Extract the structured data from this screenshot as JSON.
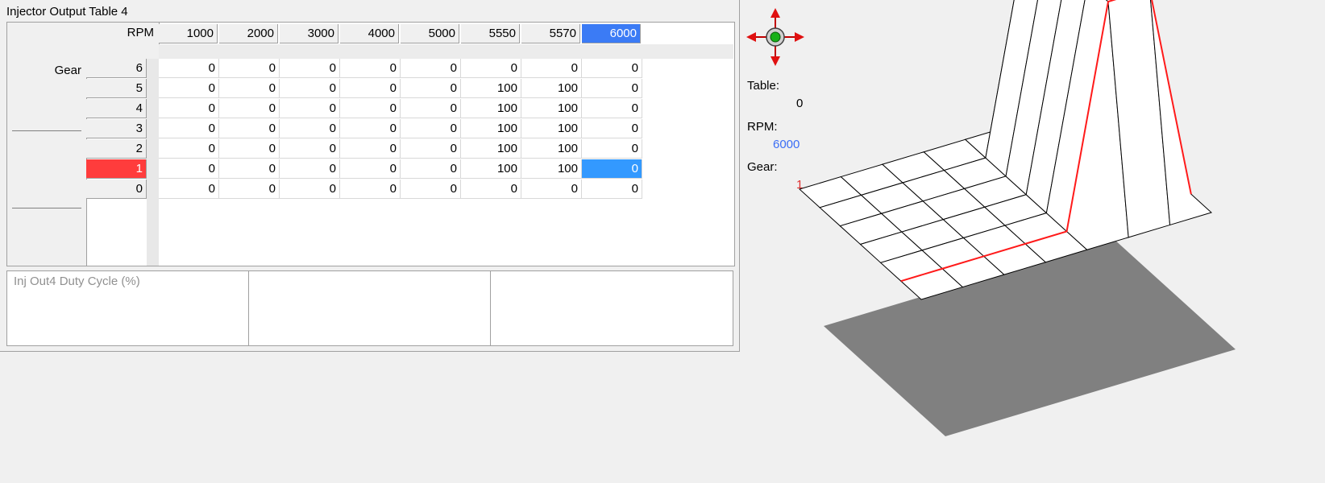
{
  "panel": {
    "title": "Injector Output Table 4"
  },
  "table": {
    "x_axis_label": "RPM",
    "y_axis_label": "Gear",
    "rpm_columns": [
      "1000",
      "2000",
      "3000",
      "4000",
      "5000",
      "5550",
      "5570",
      "6000"
    ],
    "rows": [
      {
        "gear": "6",
        "values": [
          "0",
          "0",
          "0",
          "0",
          "0",
          "0",
          "0",
          "0"
        ]
      },
      {
        "gear": "5",
        "values": [
          "0",
          "0",
          "0",
          "0",
          "0",
          "100",
          "100",
          "0"
        ]
      },
      {
        "gear": "4",
        "values": [
          "0",
          "0",
          "0",
          "0",
          "0",
          "100",
          "100",
          "0"
        ]
      },
      {
        "gear": "3",
        "values": [
          "0",
          "0",
          "0",
          "0",
          "0",
          "100",
          "100",
          "0"
        ]
      },
      {
        "gear": "2",
        "values": [
          "0",
          "0",
          "0",
          "0",
          "0",
          "100",
          "100",
          "0"
        ]
      },
      {
        "gear": "1",
        "values": [
          "0",
          "0",
          "0",
          "0",
          "0",
          "100",
          "100",
          "0"
        ]
      },
      {
        "gear": "0",
        "values": [
          "0",
          "0",
          "0",
          "0",
          "0",
          "0",
          "0",
          "0"
        ]
      }
    ],
    "selected_column": 7,
    "selected_row": 5
  },
  "status_bar": {
    "label": "Inj Out4 Duty Cycle (%)"
  },
  "info": {
    "table_label": "Table:",
    "table_value": "0",
    "rpm_label": "RPM:",
    "rpm_value": "6000",
    "gear_label": "Gear:",
    "gear_value": "1"
  },
  "colors": {
    "selected_column": "#3b7bf5",
    "selected_row": "#ff3c3c",
    "selected_cell": "#3399ff",
    "rpm_value": "#3b6ef5",
    "gear_value": "#e03030"
  },
  "icons": {
    "navigator": "move-arrows-icon"
  }
}
